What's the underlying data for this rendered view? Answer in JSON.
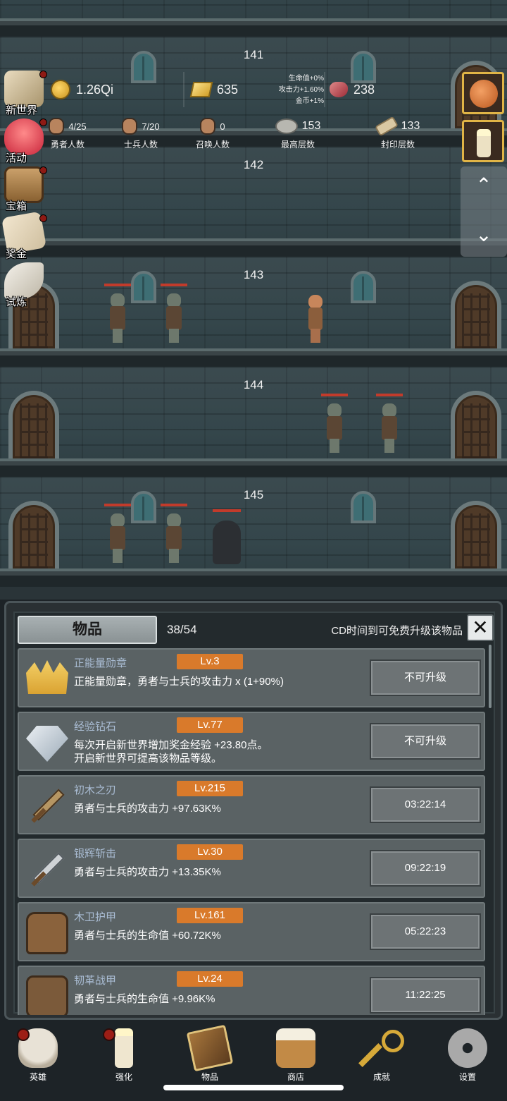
{
  "resources": {
    "coins": "1.26Qi",
    "gold": "635",
    "gems": "238",
    "bonus_hp": "生命值+0%",
    "bonus_atk": "攻击力+1.60%",
    "bonus_coin": "金币+1%"
  },
  "stats": [
    {
      "value": "4/25",
      "label": "勇者人数",
      "icon": "hero-face-icon"
    },
    {
      "value": "7/20",
      "label": "士兵人数",
      "icon": "soldier-face-icon"
    },
    {
      "value": "0",
      "label": "召唤人数",
      "icon": "summon-face-icon"
    },
    {
      "value": "153",
      "label": "最高层数",
      "icon": "stone-icon"
    },
    {
      "value": "133",
      "label": "封印层数",
      "icon": "scroll-icon"
    }
  ],
  "left_menu": [
    {
      "label": "新世界",
      "icon": "map-icon",
      "badge": true
    },
    {
      "label": "活动",
      "icon": "heart-icon",
      "badge": true
    },
    {
      "label": "宝箱",
      "icon": "chest-icon",
      "badge": true
    },
    {
      "label": "奖金",
      "icon": "envelope-icon",
      "badge": true
    },
    {
      "label": "试炼",
      "icon": "feather-icon",
      "badge": false
    }
  ],
  "floors": [
    "141",
    "142",
    "143",
    "144",
    "145"
  ],
  "scroll_controls": {
    "up": "⌃",
    "down": "⌄"
  },
  "panel": {
    "title": "物品",
    "count": "38/54",
    "hint": "CD时间到可免费升级该物品",
    "close": "✕"
  },
  "items": [
    {
      "name": "正能量勋章",
      "level": "Lv.3",
      "desc1": "正能量勋章，勇者与士兵的攻击力 x (1+90%)",
      "desc2": "",
      "button": "不可升级",
      "icon": "crown-icon"
    },
    {
      "name": "经验钻石",
      "level": "Lv.77",
      "desc1": "每次开启新世界增加奖金经验 +23.80点。",
      "desc2": "开启新世界可提高该物品等级。",
      "button": "不可升级",
      "icon": "diamond-icon"
    },
    {
      "name": "初木之刃",
      "level": "Lv.215",
      "desc1": "勇者与士兵的攻击力 +97.63K%",
      "desc2": "",
      "button": "03:22:14",
      "icon": "wooden-sword-icon"
    },
    {
      "name": "银辉斩击",
      "level": "Lv.30",
      "desc1": "勇者与士兵的攻击力 +13.35K%",
      "desc2": "",
      "button": "09:22:19",
      "icon": "silver-sword-icon"
    },
    {
      "name": "木卫护甲",
      "level": "Lv.161",
      "desc1": "勇者与士兵的生命值 +60.72K%",
      "desc2": "",
      "button": "05:22:23",
      "icon": "wooden-armor-icon"
    },
    {
      "name": "韧革战甲",
      "level": "Lv.24",
      "desc1": "勇者与士兵的生命值 +9.96K%",
      "desc2": "",
      "button": "11:22:25",
      "icon": "leather-armor-icon"
    }
  ],
  "nav": [
    {
      "label": "英雄",
      "icon": "skull-icon",
      "badge": true
    },
    {
      "label": "强化",
      "icon": "candle-icon",
      "badge": true
    },
    {
      "label": "物品",
      "icon": "book-icon",
      "badge": false
    },
    {
      "label": "商店",
      "icon": "mug-icon",
      "badge": false
    },
    {
      "label": "成就",
      "icon": "key-icon",
      "badge": false
    },
    {
      "label": "设置",
      "icon": "gear-icon",
      "badge": false
    }
  ]
}
